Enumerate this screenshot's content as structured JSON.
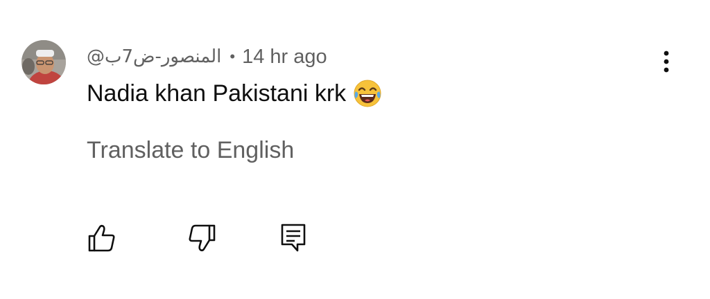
{
  "comment": {
    "author_handle": "@المنصور-ض7ب",
    "separator": "•",
    "timestamp": "14 hr ago",
    "text": "Nadia khan Pakistani krk",
    "emoji": "face-with-tears-of-joy",
    "translate_label": "Translate to English"
  },
  "actions": {
    "like_icon": "thumb-up-icon",
    "dislike_icon": "thumb-down-icon",
    "reply_icon": "reply-comment-icon",
    "menu_icon": "more-vertical-icon"
  },
  "colors": {
    "primary_text": "#0f0f0f",
    "secondary_text": "#606060",
    "background": "#ffffff"
  }
}
